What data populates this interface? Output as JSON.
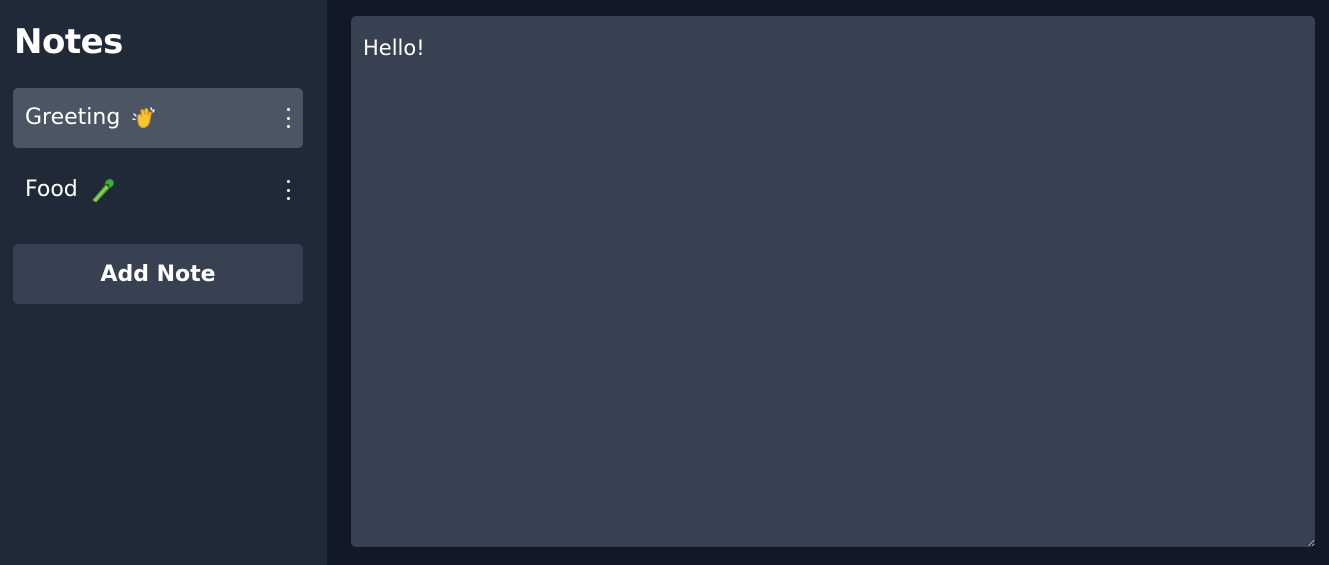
{
  "sidebar": {
    "title": "Notes",
    "notes": [
      {
        "label": "Greeting",
        "emoji": "waving-hand-icon",
        "active": true
      },
      {
        "label": "Food",
        "emoji": "celery-icon",
        "active": false
      }
    ],
    "add_button_label": "Add Note"
  },
  "editor": {
    "content": "Hello!"
  },
  "colors": {
    "app_background": "#111827",
    "sidebar_background": "#1f2937",
    "active_note_background": "#4b5563",
    "button_background": "#374151",
    "editor_background": "#374151",
    "text": "#ffffff"
  }
}
